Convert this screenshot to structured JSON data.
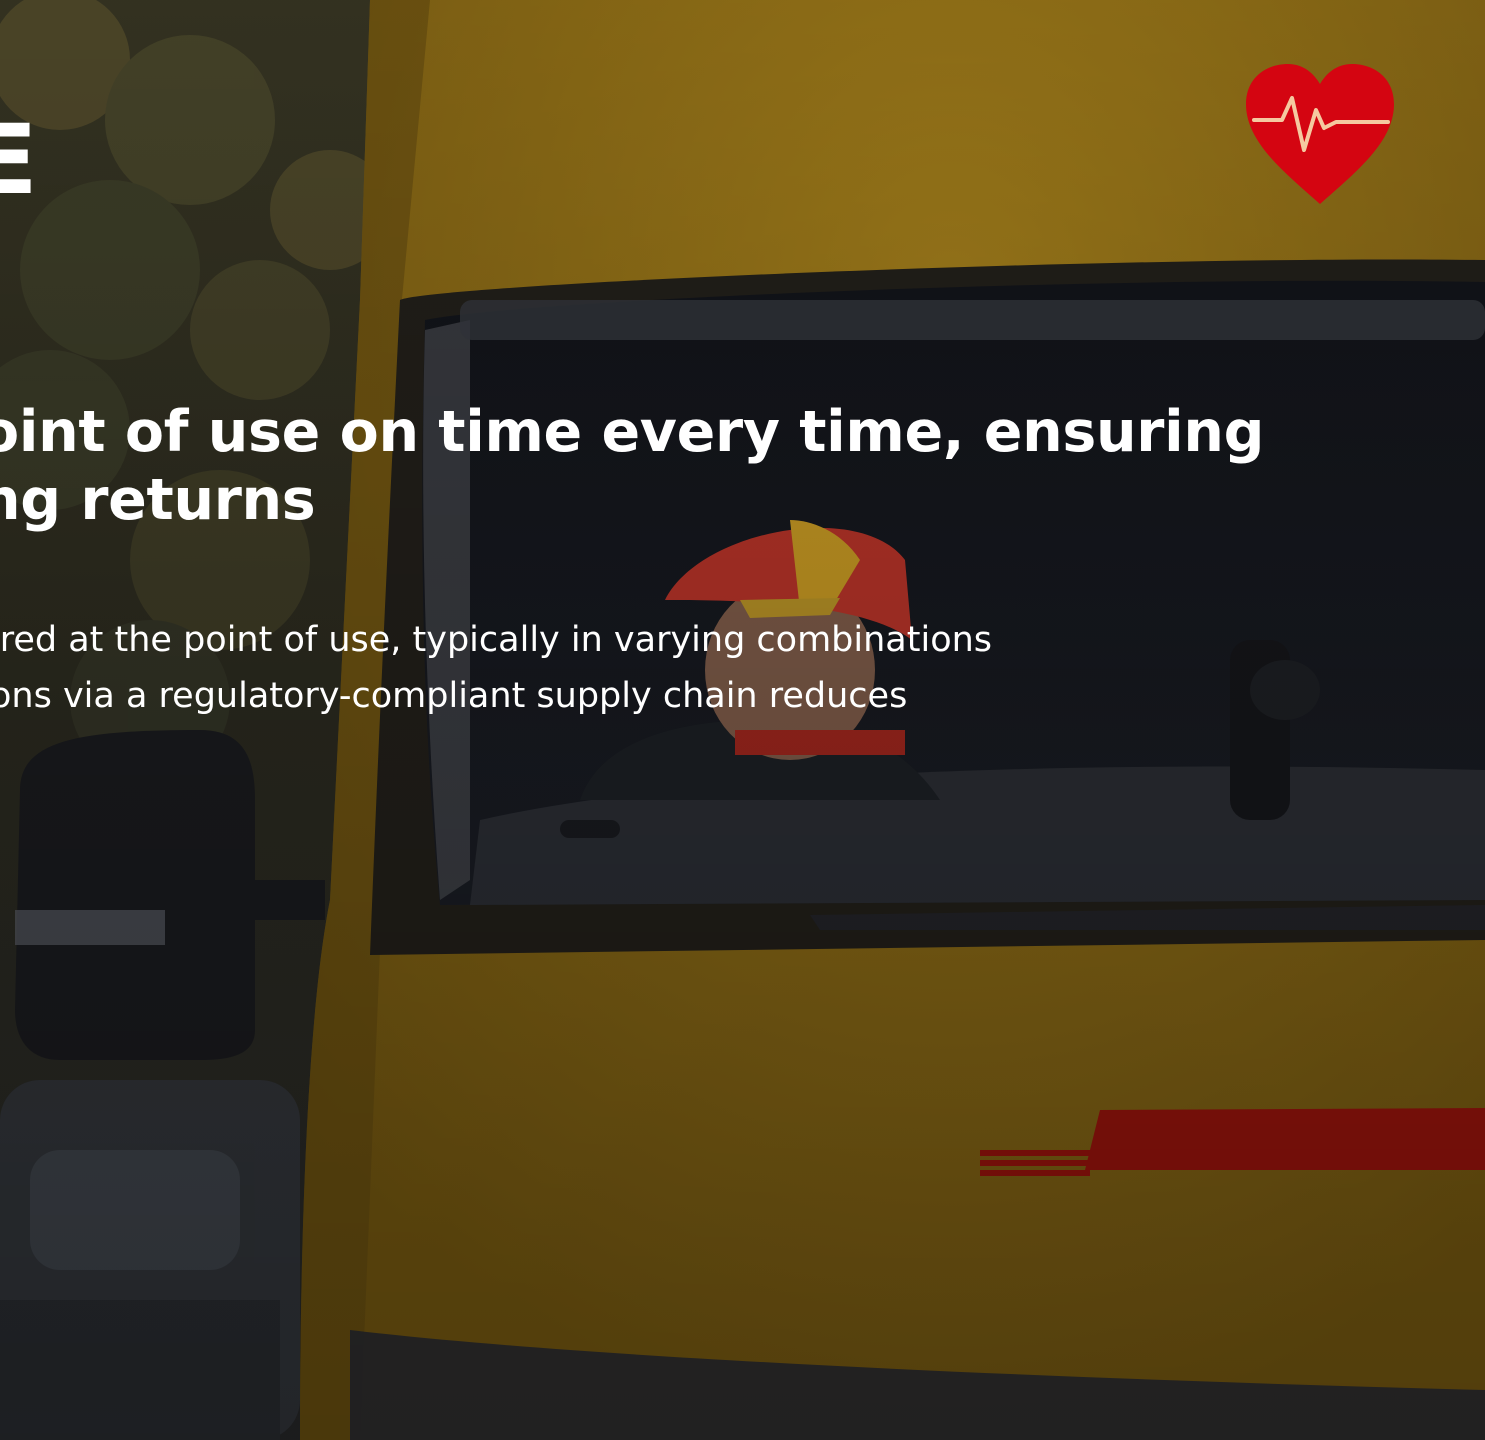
{
  "hero": {
    "heading_fragment": "E",
    "headline": [
      "oint of use on time every time, ensuring",
      "ng returns"
    ],
    "body": [
      "ired at the point of use, typically in varying combinations",
      "ons via a regulatory-compliant supply chain reduces"
    ]
  },
  "badge": {
    "icon": "heart-pulse-icon",
    "color": "#d40511"
  },
  "photo": {
    "van_color": "#f2b500",
    "logo_color": "#d40511",
    "cap_red": "#e2262a",
    "cap_yellow": "#f6c400"
  }
}
